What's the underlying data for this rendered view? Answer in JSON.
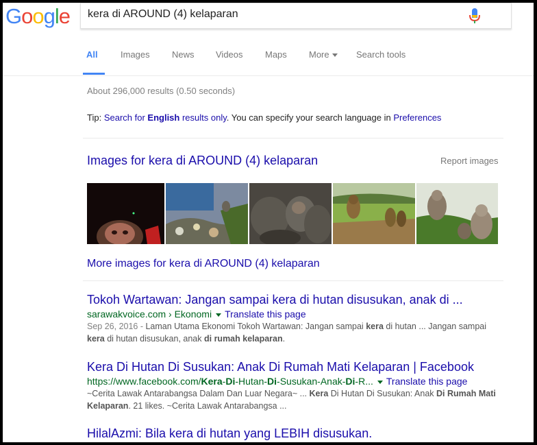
{
  "logo": {
    "text": "Google"
  },
  "search": {
    "query": "kera di AROUND (4) kelaparan"
  },
  "tabs": [
    {
      "label": "All"
    },
    {
      "label": "Images"
    },
    {
      "label": "News"
    },
    {
      "label": "Videos"
    },
    {
      "label": "Maps"
    },
    {
      "label": "More"
    },
    {
      "label": "Search tools"
    }
  ],
  "stats": "About 296,000 results (0.50 seconds)",
  "tip": {
    "prefix": "Tip: ",
    "link_start": "Search for ",
    "link_bold": "English",
    "link_end": " results only",
    "middle": ". You can specify your search language in ",
    "preferences": "Preferences"
  },
  "images_block": {
    "title": "Images for kera di AROUND (4) kelaparan",
    "report": "Report images",
    "more": "More images for kera di AROUND (4) kelaparan"
  },
  "results": [
    {
      "title": "Tokoh Wartawan: Jangan sampai kera di hutan disusukan, anak di ...",
      "url": "sarawakvoice.com",
      "breadcrumb": " › Ekonomi",
      "translate": "Translate this page",
      "date": "Sep 26, 2016 - ",
      "snippet_1": "Laman Utama Ekonomi Tokoh Wartawan: Jangan sampai ",
      "snippet_b1": "kera",
      "snippet_2": " di hutan ... Jangan sampai ",
      "snippet_b2": "kera",
      "snippet_3": " di hutan disusukan, anak ",
      "snippet_b3": "di rumah kelaparan",
      "snippet_4": "."
    },
    {
      "title": "Kera Di Hutan Di Susukan: Anak Di Rumah Mati Kelaparan | Facebook",
      "url_1": "https://www.facebook.com/",
      "url_b1": "Kera",
      "url_2": "-",
      "url_b2": "Di",
      "url_3": "-Hutan-",
      "url_b3": "Di",
      "url_4": "-Susukan-Anak-",
      "url_b4": "Di",
      "url_5": "-R...",
      "translate": "Translate this page",
      "snippet_1": "~Cerita Lawak Antarabangsa Dalam Dan Luar Negara~ ... ",
      "snippet_b1": "Kera",
      "snippet_2": " Di Hutan Di Susukan: Anak ",
      "snippet_b2": "Di Rumah Mati Kelaparan",
      "snippet_3": ". 21 likes. ~Cerita Lawak Antarabangsa ..."
    },
    {
      "title": "HilalAzmi: Bila kera di hutan yang LEBIH disusukan."
    }
  ]
}
